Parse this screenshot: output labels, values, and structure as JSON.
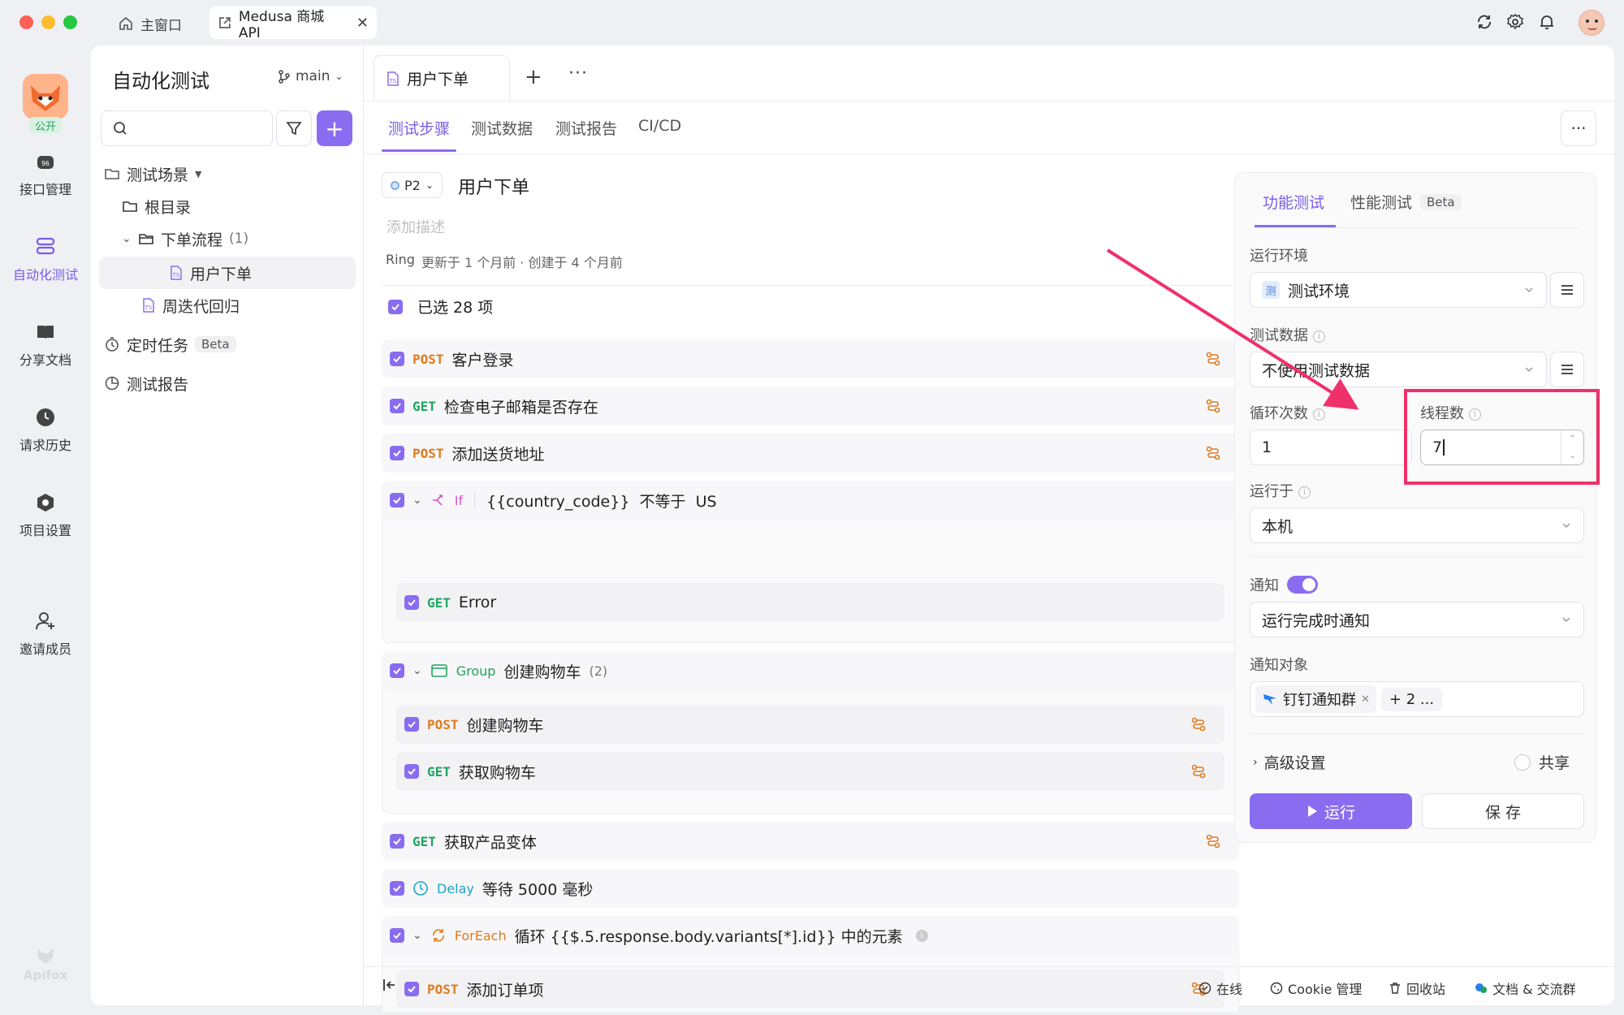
{
  "titlebar": {
    "home_tab": "主窗口",
    "active_tab": "Medusa 商城 API"
  },
  "rail": {
    "badge": "公开",
    "items": [
      {
        "label": "接口管理",
        "icon": "api-icon"
      },
      {
        "label": "自动化测试",
        "icon": "automation-icon"
      },
      {
        "label": "分享文档",
        "icon": "book-icon"
      },
      {
        "label": "请求历史",
        "icon": "clock-icon"
      },
      {
        "label": "项目设置",
        "icon": "settings-hex-icon"
      },
      {
        "label": "邀请成员",
        "icon": "add-user-icon"
      }
    ],
    "brand": "Apifox"
  },
  "sidebar": {
    "title": "自动化测试",
    "branch": "main",
    "tree": {
      "scenes": "测试场景",
      "root": "根目录",
      "folder": "下单流程",
      "folder_count": "(1)",
      "item_active": "用户下单",
      "item2": "周迭代回归",
      "scheduled": "定时任务",
      "beta": "Beta",
      "reports": "测试报告"
    }
  },
  "main": {
    "doc_tab": "用户下单",
    "subtabs": [
      "测试步骤",
      "测试数据",
      "测试报告",
      "CI/CD"
    ],
    "priority": "P2",
    "title": "用户下单",
    "desc_placeholder": "添加描述",
    "meta_user": "Ring",
    "meta_text": "更新于 1 个月前 · 创建于 4 个月前",
    "selected": "已选 28 项",
    "steps": {
      "s1": {
        "method": "POST",
        "name": "客户登录"
      },
      "s2": {
        "method": "GET",
        "name": "检查电子邮箱是否存在"
      },
      "s3": {
        "method": "POST",
        "name": "添加送货地址"
      },
      "s4": {
        "type": "If",
        "expr": "{{country_code}}  不等于  US"
      },
      "s4a": {
        "method": "GET",
        "name": "Error"
      },
      "s5": {
        "type": "Group",
        "name": "创建购物车",
        "count": "(2)"
      },
      "s5a": {
        "method": "POST",
        "name": "创建购物车"
      },
      "s5b": {
        "method": "GET",
        "name": "获取购物车"
      },
      "s6": {
        "method": "GET",
        "name": "获取产品变体"
      },
      "s7": {
        "type": "Delay",
        "name": "等待 5000 毫秒"
      },
      "s8": {
        "type": "ForEach",
        "name": "循环 {{$.5.response.body.variants[*].id}} 中的元素"
      },
      "s8a": {
        "method": "POST",
        "name": "添加订单项"
      }
    }
  },
  "panel": {
    "tab_func": "功能测试",
    "tab_perf": "性能测试",
    "beta": "Beta",
    "env_label": "运行环境",
    "env_badge": "测",
    "env_value": "测试环境",
    "data_label": "测试数据",
    "data_value": "不使用测试数据",
    "loop_label": "循环次数",
    "loop_value": "1",
    "thread_label": "线程数",
    "thread_value": "7",
    "runon_label": "运行于",
    "runon_value": "本机",
    "notify_label": "通知",
    "notify_on": true,
    "notify_value": "运行完成时通知",
    "target_label": "通知对象",
    "target_chip": "钉钉通知群",
    "target_more": "+ 2 ...",
    "advanced": "高级设置",
    "share": "共享",
    "run_button": "运行",
    "save_button": "保 存"
  },
  "bottombar": {
    "online": "在线",
    "cookie": "Cookie 管理",
    "trash": "回收站",
    "docs": "文档 & 交流群"
  },
  "colors": {
    "accent": "#8a6cf0",
    "post": "#e07a1e",
    "get": "#1fa45f",
    "annotation": "#f0306a"
  }
}
